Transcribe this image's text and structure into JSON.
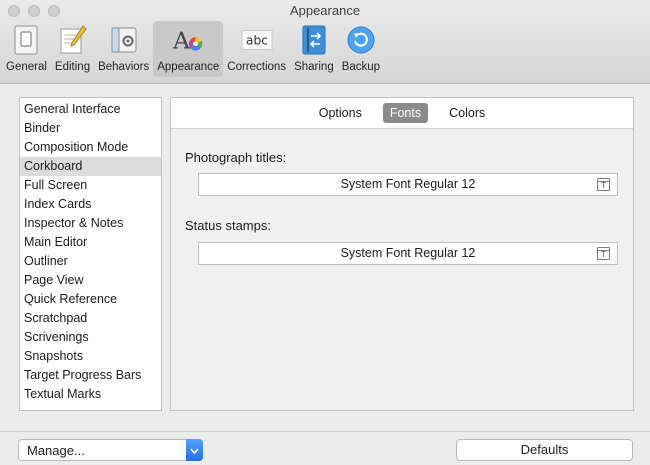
{
  "window": {
    "title": "Appearance"
  },
  "toolbar": {
    "items": [
      {
        "label": "General",
        "icon": "general-icon",
        "active": false
      },
      {
        "label": "Editing",
        "icon": "editing-icon",
        "active": false
      },
      {
        "label": "Behaviors",
        "icon": "behaviors-icon",
        "active": false
      },
      {
        "label": "Appearance",
        "icon": "appearance-icon",
        "active": true
      },
      {
        "label": "Corrections",
        "icon": "corrections-icon",
        "icon_text": "abc",
        "active": false
      },
      {
        "label": "Sharing",
        "icon": "sharing-icon",
        "active": false
      },
      {
        "label": "Backup",
        "icon": "backup-icon",
        "active": false
      }
    ]
  },
  "sidebar": {
    "selected": "Corkboard",
    "items": [
      "General Interface",
      "Binder",
      "Composition Mode",
      "Corkboard",
      "Full Screen",
      "Index Cards",
      "Inspector & Notes",
      "Main Editor",
      "Outliner",
      "Page View",
      "Quick Reference",
      "Scratchpad",
      "Scrivenings",
      "Snapshots",
      "Target Progress Bars",
      "Textual Marks"
    ]
  },
  "tabs": {
    "selected": "Fonts",
    "items": [
      "Options",
      "Fonts",
      "Colors"
    ]
  },
  "fonts": {
    "photograph_titles": {
      "label": "Photograph titles:",
      "value": "System Font Regular 12"
    },
    "status_stamps": {
      "label": "Status stamps:",
      "value": "System Font Regular 12"
    },
    "font_button_glyph": "T"
  },
  "footer": {
    "manage_label": "Manage...",
    "defaults_label": "Defaults"
  },
  "colors": {
    "accent": "#2a7cf0",
    "selected_tab": "#8b8b8b",
    "selected_row": "#dcdcdc"
  }
}
